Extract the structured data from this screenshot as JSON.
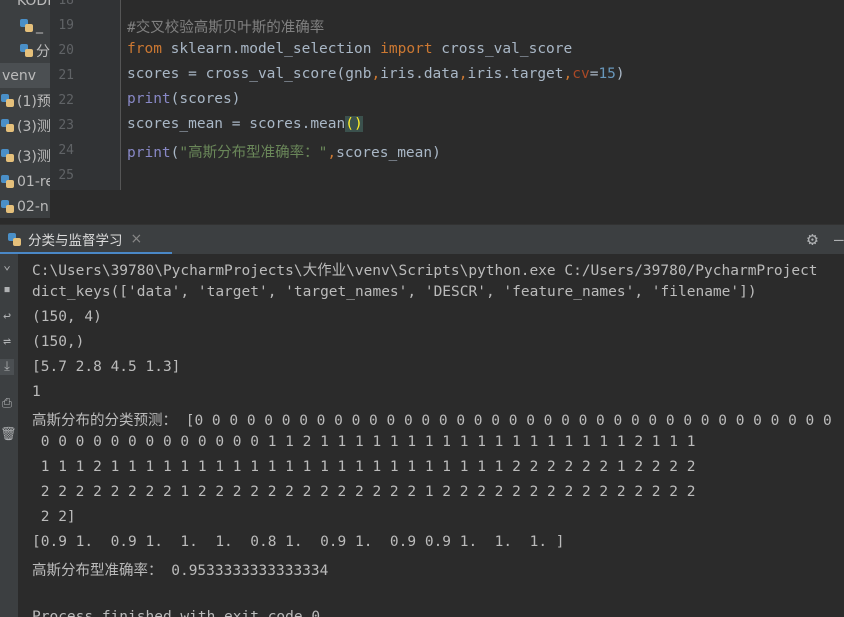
{
  "project_tree": {
    "items": [
      {
        "label": "KODI"
      },
      {
        "label": "_"
      },
      {
        "label": "分"
      },
      {
        "label": "venv"
      },
      {
        "label": "(1)预"
      },
      {
        "label": "(3)测"
      },
      {
        "label": "(3)测"
      },
      {
        "label": "01-re"
      },
      {
        "label": "02-n"
      }
    ]
  },
  "editor": {
    "line_numbers": [
      "18",
      "19",
      "20",
      "21",
      "22",
      "23",
      "24",
      "25"
    ],
    "lines": {
      "l19": {
        "comment": "#交叉校验高斯贝叶斯的准确率"
      },
      "l20": {
        "kw_from": "from",
        "module": " sklearn.model_selection ",
        "kw_import": "import",
        "name": " cross_val_score"
      },
      "l21": {
        "a": "scores = cross_val_score(gnb",
        "c1": ",",
        "b": "iris.data",
        "c2": ",",
        "d": "iris.target",
        "c3": ",",
        "param": "cv",
        "eq": "=",
        "num": "15",
        "end": ")"
      },
      "l22": {
        "fn": "print",
        "rest": "(scores)"
      },
      "l23": {
        "a": "scores_mean = scores.mean",
        "paren": "()"
      },
      "l24": {
        "fn": "print",
        "open": "(",
        "str": "\"高斯分布型准确率：\"",
        "comma": ",",
        "rest": "scores_mean)"
      }
    }
  },
  "run_panel": {
    "tab_label": "分类与监督学习",
    "tab_close": "×",
    "gear": "⚙",
    "output": [
      "C:\\Users\\39780\\PycharmProjects\\大作业\\venv\\Scripts\\python.exe C:/Users/39780/PycharmProject",
      "dict_keys(['data', 'target', 'target_names', 'DESCR', 'feature_names', 'filename'])",
      "(150, 4)",
      "(150,)",
      "[5.7 2.8 4.5 1.3]",
      "1",
      "高斯分布的分类预测： [0 0 0 0 0 0 0 0 0 0 0 0 0 0 0 0 0 0 0 0 0 0 0 0 0 0 0 0 0 0 0 0 0 0 0 0 0",
      " 0 0 0 0 0 0 0 0 0 0 0 0 0 1 1 2 1 1 1 1 1 1 1 1 1 1 1 1 1 1 1 1 1 1 2 1 1 1",
      " 1 1 1 2 1 1 1 1 1 1 1 1 1 1 1 1 1 1 1 1 1 1 1 1 1 1 1 2 2 2 2 2 2 1 2 2 2 2",
      " 2 2 2 2 2 2 2 2 1 2 2 2 2 2 2 2 2 2 2 2 2 2 1 2 2 2 2 2 2 2 2 2 2 2 2 2 2 2",
      " 2 2]",
      "[0.9 1.  0.9 1.  1.  1.  0.8 1.  0.9 1.  0.9 0.9 1.  1.  1. ]",
      "高斯分布型准确率： 0.9533333333333334",
      "",
      "Process finished with exit code 0"
    ]
  }
}
